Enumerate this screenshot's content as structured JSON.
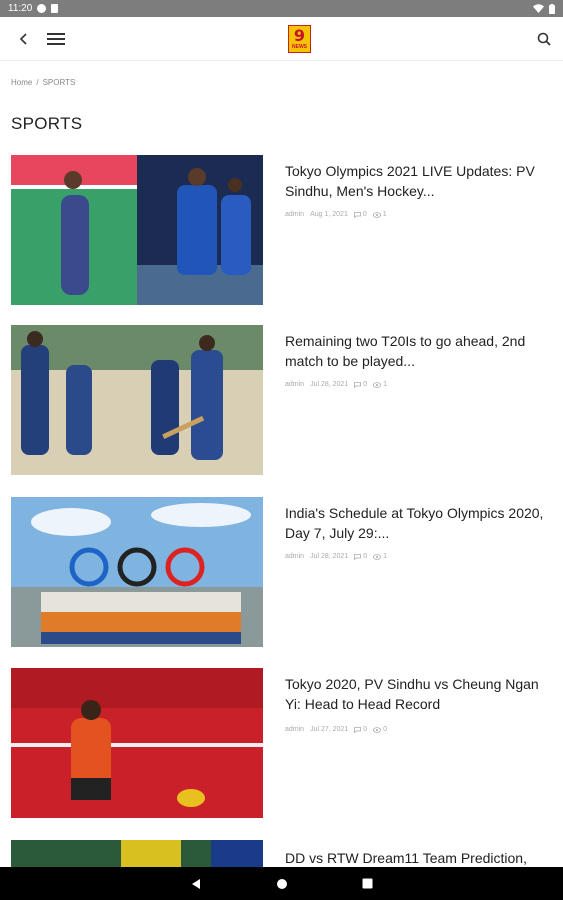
{
  "status_bar": {
    "time": "11:20"
  },
  "breadcrumb": {
    "home": "Home",
    "separator": "/",
    "current": "SPORTS"
  },
  "page": {
    "title": "SPORTS"
  },
  "articles": [
    {
      "title": "Tokyo Olympics 2021 LIVE Updates: PV Sindhu, Men's Hockey...",
      "author": "admin",
      "date": "Aug 1, 2021",
      "comments": "0",
      "views": "1"
    },
    {
      "title": "Remaining two T20Is to go ahead, 2nd match to be played...",
      "author": "admin",
      "date": "Jul 28, 2021",
      "comments": "0",
      "views": "1"
    },
    {
      "title": "India's Schedule at Tokyo Olympics 2020, Day 7, July 29:...",
      "author": "admin",
      "date": "Jul 28, 2021",
      "comments": "0",
      "views": "1"
    },
    {
      "title": "Tokyo 2020, PV Sindhu vs Cheung Ngan Yi: Head to Head Record",
      "author": "admin",
      "date": "Jul 27, 2021",
      "comments": "0",
      "views": "0"
    },
    {
      "title": "DD vs RTW Dream11 Team Prediction,",
      "author": "",
      "date": "",
      "comments": "",
      "views": ""
    }
  ],
  "colors": {
    "logo_bg": "#f4c400",
    "logo_text": "#c8102e",
    "status_bar": "#7d7d7d",
    "nav_bar": "#000000"
  },
  "icons": {
    "back": "chevron-left-icon",
    "menu": "hamburger-menu-icon",
    "search": "search-icon",
    "comment": "comment-icon",
    "views": "eye-icon"
  }
}
